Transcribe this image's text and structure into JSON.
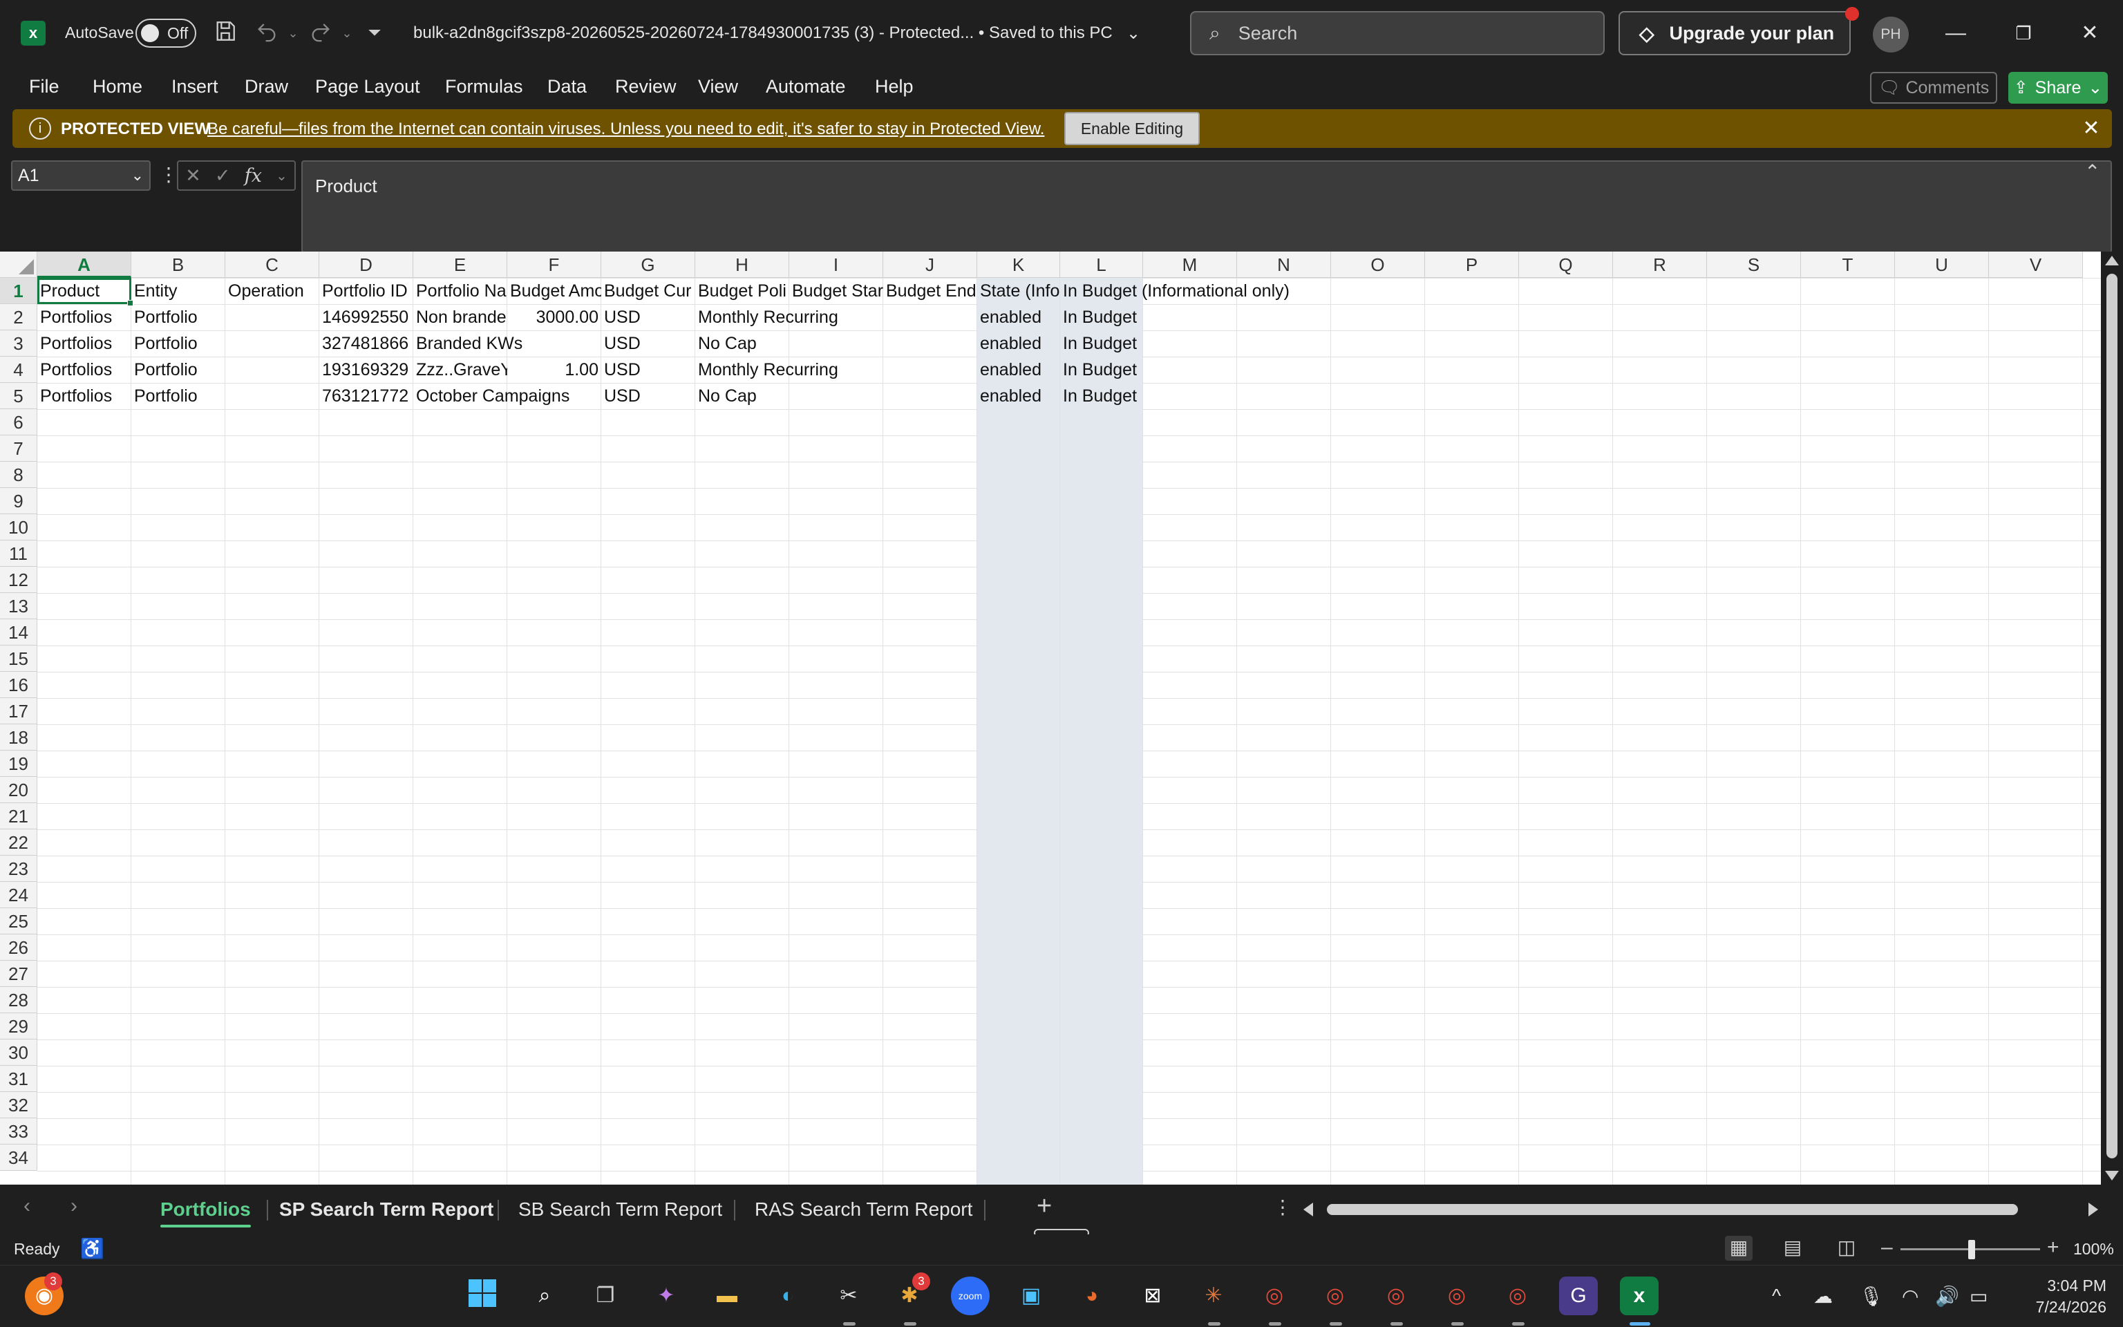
{
  "titlebar": {
    "autosave_label": "AutoSave",
    "autosave_state": "Off",
    "document_title": "bulk-a2dn8gcif3szp8-20260525-20260724-1784930001735 (3)  -  Protected...  •  Saved to this PC",
    "search_placeholder": "Search",
    "upgrade_label": "Upgrade your plan",
    "avatar_initials": "PH"
  },
  "menu": {
    "items": [
      "File",
      "Home",
      "Insert",
      "Draw",
      "Page Layout",
      "Formulas",
      "Data",
      "Review",
      "View",
      "Automate",
      "Help"
    ],
    "comments_label": "Comments",
    "share_label": "Share"
  },
  "protected_view": {
    "title": "PROTECTED VIEW",
    "message": "Be careful—files from the Internet can contain viruses. Unless you need to edit, it's safer to stay in Protected View.",
    "enable_label": "Enable Editing",
    "bar_color": "#6e5200"
  },
  "formula_bar": {
    "name_box": "A1",
    "fx_label": "fx",
    "content": "Product"
  },
  "grid": {
    "columns": [
      "A",
      "B",
      "C",
      "D",
      "E",
      "F",
      "G",
      "H",
      "I",
      "J",
      "K",
      "L",
      "M",
      "N",
      "O",
      "P",
      "Q",
      "R",
      "S",
      "T",
      "U",
      "V"
    ],
    "rows": [
      "1",
      "2",
      "3",
      "4",
      "5",
      "6",
      "7",
      "8",
      "9",
      "10",
      "11",
      "12",
      "13",
      "14",
      "15",
      "16",
      "17",
      "18",
      "19",
      "20",
      "21",
      "22",
      "23",
      "24",
      "25",
      "26",
      "27",
      "28",
      "29",
      "30",
      "31",
      "32",
      "33",
      "34"
    ],
    "headers": [
      "Product",
      "Entity",
      "Operation",
      "Portfolio ID",
      "Portfolio Na",
      "Budget Amo",
      "Budget Cur",
      "Budget Poli",
      "Budget Star",
      "Budget End",
      "State (Info",
      "In Budget (Informational only)"
    ],
    "data": [
      [
        "Portfolios",
        "Portfolio",
        "",
        "146992550",
        "Non brande",
        "3000.00",
        "USD",
        "Monthly Recurring",
        "",
        "",
        "enabled",
        "In Budget"
      ],
      [
        "Portfolios",
        "Portfolio",
        "",
        "327481866",
        "Branded KWs",
        "",
        "USD",
        "No Cap",
        "",
        "",
        "enabled",
        "In Budget"
      ],
      [
        "Portfolios",
        "Portfolio",
        "",
        "193169329",
        "Zzz..GraveY",
        "1.00",
        "USD",
        "Monthly Recurring",
        "",
        "",
        "enabled",
        "In Budget"
      ],
      [
        "Portfolios",
        "Portfolio",
        "",
        "763121772",
        "October Campaigns",
        "",
        "USD",
        "No Cap",
        "",
        "",
        "enabled",
        "In Budget"
      ]
    ],
    "accent_color": "#107c41"
  },
  "sheets": {
    "tabs": [
      "Portfolios",
      "SP Search Term Report",
      "SB Search Term Report",
      "RAS Search Term Report"
    ],
    "active": "Portfolios"
  },
  "status": {
    "ready": "Ready",
    "zoom": "100%"
  },
  "taskbar": {
    "firefox_badge": "3",
    "slack_badge": "3",
    "zoom_label": "zoom",
    "time": "3:04 PM",
    "date": "7/24/2026"
  }
}
